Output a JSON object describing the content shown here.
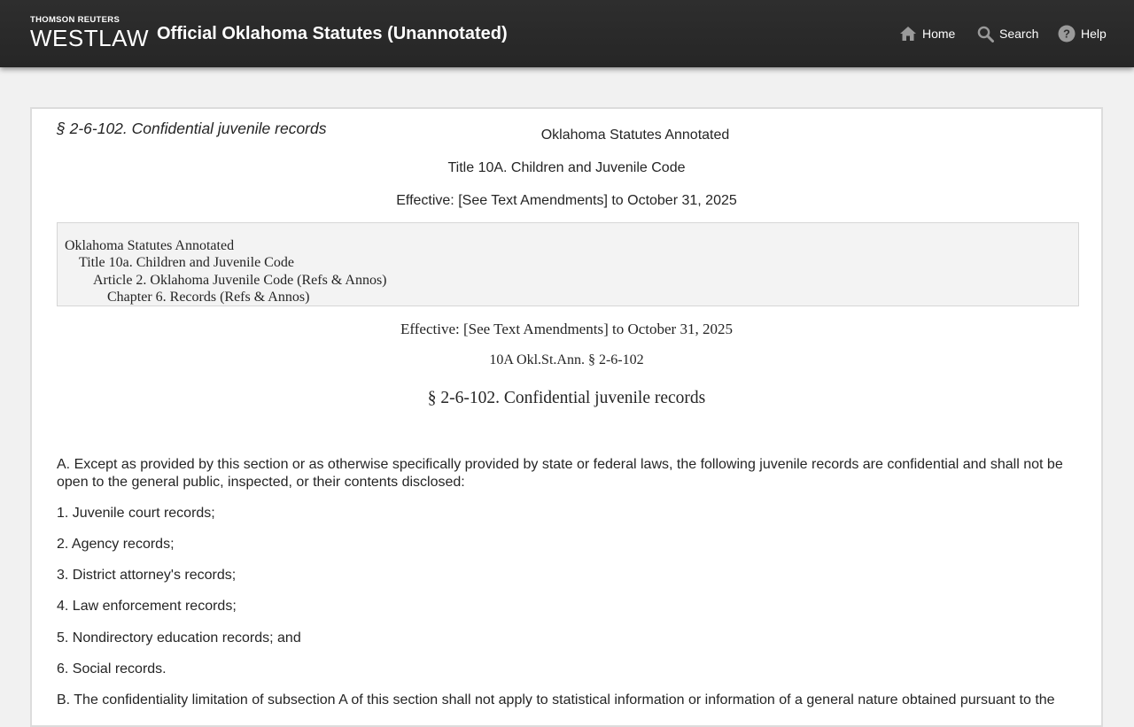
{
  "header": {
    "brand_small": "THOMSON REUTERS",
    "brand_big": "WESTLAW",
    "app_title": "Official Oklahoma Statutes (Unannotated)",
    "nav": {
      "home": "Home",
      "search": "Search",
      "help": "Help"
    }
  },
  "document": {
    "section_heading": "§ 2-6-102. Confidential juvenile records",
    "publication": "Oklahoma Statutes Annotated",
    "title_line": "Title 10A. Children and Juvenile Code",
    "effective_line": "Effective: [See Text Amendments] to October 31, 2025",
    "toc": [
      "Oklahoma Statutes Annotated",
      "Title 10a. Children and Juvenile Code",
      "Article 2. Oklahoma Juvenile Code (Refs & Annos)",
      "Chapter 6. Records (Refs & Annos)"
    ],
    "effective_line_serif": "Effective: [See Text Amendments] to October 31, 2025",
    "citation": "10A Okl.St.Ann. § 2-6-102",
    "section_title": "§ 2-6-102. Confidential juvenile records",
    "paragraphs": [
      "A. Except as provided by this section or as otherwise specifically provided by state or federal laws, the following juvenile records are confidential and shall not be open to the general public, inspected, or their contents disclosed:",
      "1. Juvenile court records;",
      "2. Agency records;",
      "3. District attorney's records;",
      "4. Law enforcement records;",
      "5. Nondirectory education records; and",
      "6. Social records.",
      "B. The confidentiality limitation of subsection A of this section shall not apply to statistical information or information of a general nature obtained pursuant to the"
    ]
  },
  "colors": {
    "header_bg": "#2b2b2b",
    "page_bg": "#f1f1f1",
    "toc_bg": "#f3f3f3",
    "text": "#252525"
  }
}
